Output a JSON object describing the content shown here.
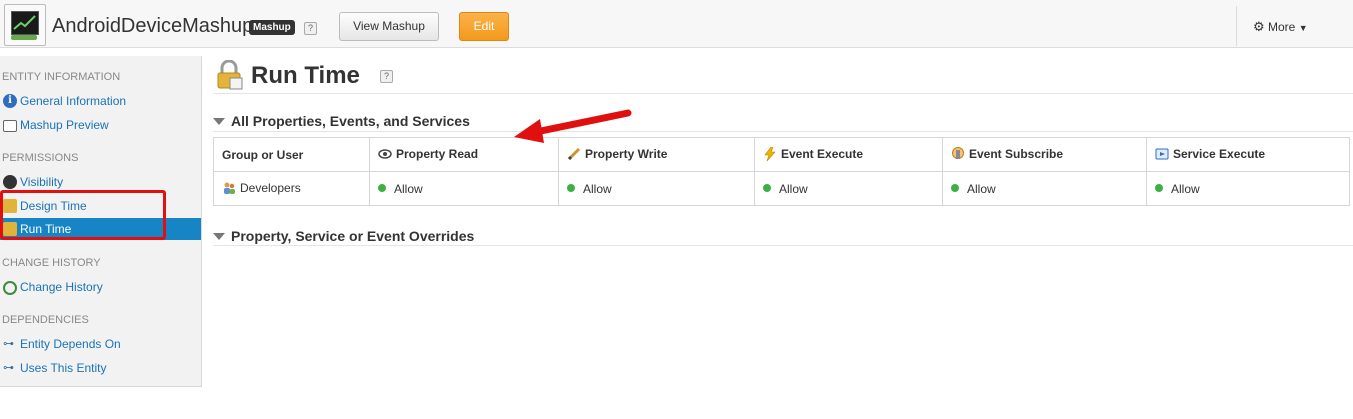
{
  "header": {
    "entity_name": "AndroidDeviceMashup",
    "type_badge": "Mashup",
    "help": "?",
    "view_button": "View Mashup",
    "edit_button": "Edit",
    "more_menu": "More"
  },
  "sidebar": {
    "sections": [
      {
        "title": "ENTITY INFORMATION",
        "items": [
          {
            "label": "General Information",
            "icon": "info-icon"
          },
          {
            "label": "Mashup Preview",
            "icon": "preview-icon"
          }
        ]
      },
      {
        "title": "PERMISSIONS",
        "items": [
          {
            "label": "Visibility",
            "icon": "eye-icon"
          },
          {
            "label": "Design Time",
            "icon": "lock-icon"
          },
          {
            "label": "Run Time",
            "icon": "lock-icon",
            "active": true
          }
        ]
      },
      {
        "title": "CHANGE HISTORY",
        "items": [
          {
            "label": "Change History",
            "icon": "history-icon"
          }
        ]
      },
      {
        "title": "DEPENDENCIES",
        "items": [
          {
            "label": "Entity Depends On",
            "icon": "dependency-icon"
          },
          {
            "label": "Uses This Entity",
            "icon": "dependency-icon"
          }
        ]
      }
    ]
  },
  "main": {
    "title": "Run Time",
    "help": "?",
    "section1_title": "All Properties, Events, and Services",
    "section2_title": "Property, Service or Event Overrides",
    "table": {
      "headers": [
        "Group or User",
        "Property Read",
        "Property Write",
        "Event Execute",
        "Event Subscribe",
        "Service Execute"
      ],
      "rows": [
        {
          "name": "Developers",
          "values": [
            "Allow",
            "Allow",
            "Allow",
            "Allow",
            "Allow"
          ]
        }
      ]
    }
  },
  "colors": {
    "accent": "#1784c6",
    "edit_orange": "#f39a1c",
    "allow_green": "#3cb043",
    "annotation_red": "#e01010"
  }
}
